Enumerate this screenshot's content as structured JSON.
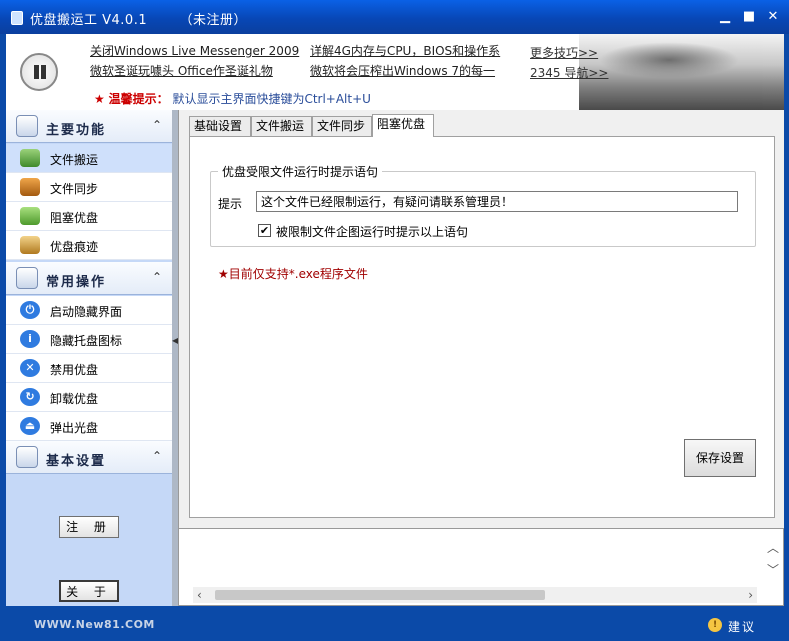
{
  "window": {
    "title": "优盘搬运工 V4.0.1",
    "status": "（未注册）"
  },
  "banner": {
    "news": [
      "关闭Windows Live Messenger 2009",
      "微软圣诞玩噱头 Office作圣诞礼物",
      "详解4G内存与CPU，BIOS和操作系",
      "微软将会压榨出Windows 7的每一"
    ],
    "more": [
      "更多技巧>>",
      "2345 导航>>"
    ],
    "tip_label": "温馨提示：",
    "tip_text": "默认显示主界面快捷键为Ctrl+Alt+U"
  },
  "sidebar": {
    "main_section": "主要功能",
    "main_items": [
      "文件搬运",
      "文件同步",
      "阻塞优盘",
      "优盘痕迹"
    ],
    "ops_section": "常用操作",
    "ops_items": [
      "启动隐藏界面",
      "隐藏托盘图标",
      "禁用优盘",
      "卸载优盘",
      "弹出光盘"
    ],
    "settings_section": "基本设置",
    "register_label": "注 册",
    "about_label": "关 于"
  },
  "tabs": [
    "基础设置",
    "文件搬运",
    "文件同步",
    "阻塞优盘"
  ],
  "active_tab": 3,
  "panel": {
    "group_title": "优盘受限文件运行时提示语句",
    "prompt_label": "提示",
    "prompt_value": "这个文件已经限制运行，有疑问请联系管理员！",
    "checkbox_label": "被限制文件企图运行时提示以上语句",
    "checkbox_checked": true,
    "note": "★目前仅支持*.exe程序文件",
    "save_label": "保存设置"
  },
  "status": {
    "site": "WWW.New81.COM",
    "suggest_label": "建议"
  }
}
